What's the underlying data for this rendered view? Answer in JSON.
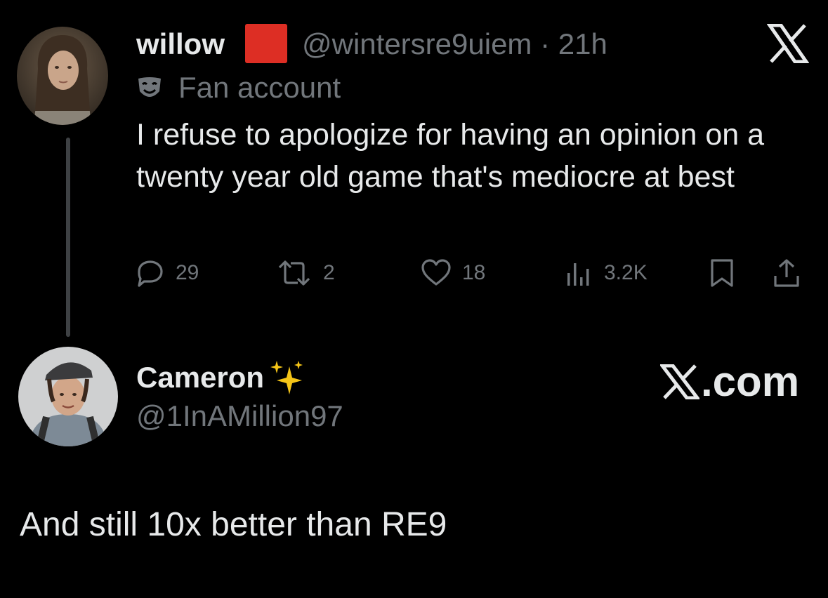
{
  "parent_tweet": {
    "display_name": "willow",
    "name_badge_color": "#dd2e24",
    "handle": "@wintersre9uiem",
    "separator": "·",
    "timestamp": "21h",
    "label_icon": "fan-mask-icon",
    "label": "Fan account",
    "text": "I refuse to apologize for having an opinion on a twenty year old game that's mediocre at best",
    "actions": {
      "replies": "29",
      "reposts": "2",
      "likes": "18",
      "views": "3.2K"
    }
  },
  "reply": {
    "display_name": "Cameron",
    "name_emoji": "sparkles-icon",
    "handle": "@1InAMillion97",
    "text": "And still 10x better than RE9"
  },
  "branding": {
    "top_logo": "x-logo-icon",
    "site": ".com"
  },
  "colors": {
    "background": "#000000",
    "primary_text": "#e7e9ea",
    "secondary_text": "#71767b",
    "thread_line": "#3e4144"
  }
}
